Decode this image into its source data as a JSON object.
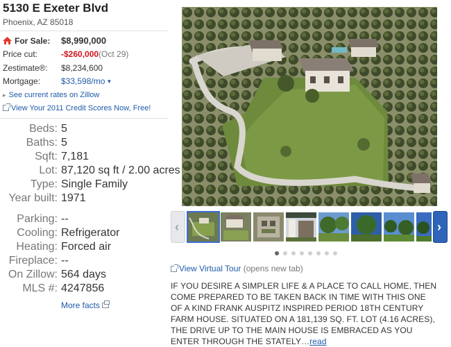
{
  "listing": {
    "address": "5130 E Exeter Blvd",
    "city_line": "Phoenix, AZ 85018"
  },
  "price": {
    "for_sale_label": "For Sale:",
    "for_sale_value": "$8,990,000",
    "price_cut_label": "Price cut:",
    "price_cut_value": "-$260,000",
    "price_cut_date": "(Oct 29)",
    "zestimate_label": "Zestimate®:",
    "zestimate_value": "$8,234,600",
    "mortgage_label": "Mortgage:",
    "mortgage_value": "$33,598/mo",
    "accent_red": "#d0151b",
    "link_blue": "#1f5aa8"
  },
  "links": {
    "rates": "See current rates on Zillow",
    "credit": "View Your 2011 Credit Scores Now, Free!",
    "more_facts": "More facts"
  },
  "facts": [
    {
      "label": "Beds:",
      "value": "5"
    },
    {
      "label": "Baths:",
      "value": "5"
    },
    {
      "label": "Sqft:",
      "value": "7,181"
    },
    {
      "label": "Lot:",
      "value": "87,120 sq ft / 2.00 acres"
    },
    {
      "label": "Type:",
      "value": "Single Family"
    },
    {
      "label": "Year built:",
      "value": "1971"
    },
    {
      "label": "Parking:",
      "value": "--"
    },
    {
      "label": "Cooling:",
      "value": "Refrigerator"
    },
    {
      "label": "Heating:",
      "value": "Forced air"
    },
    {
      "label": "Fireplace:",
      "value": "--"
    },
    {
      "label": "On Zillow:",
      "value": "564 days"
    },
    {
      "label": "MLS #:",
      "value": "4247856"
    }
  ],
  "gallery": {
    "thumb_count": 8,
    "selected_index": 0,
    "dot_count": 8,
    "active_dot": 0
  },
  "virtual_tour": {
    "label": "View Virtual Tour",
    "note": "(opens new tab)"
  },
  "description": {
    "text": "IF YOU DESIRE A SIMPLER LIFE & A PLACE TO CALL HOME, THEN COME PREPARED TO BE TAKEN BACK IN TIME WITH THIS ONE OF A KIND FRANK AUSPITZ INSPIRED PERIOD 18TH CENTURY FARM HOUSE. SITUATED ON A 181,139 SQ. FT. LOT (4.16 ACRES), THE DRIVE UP TO THE MAIN HOUSE IS EMBRACED AS YOU ENTER THROUGH THE STATELY…",
    "read_more": "read"
  }
}
